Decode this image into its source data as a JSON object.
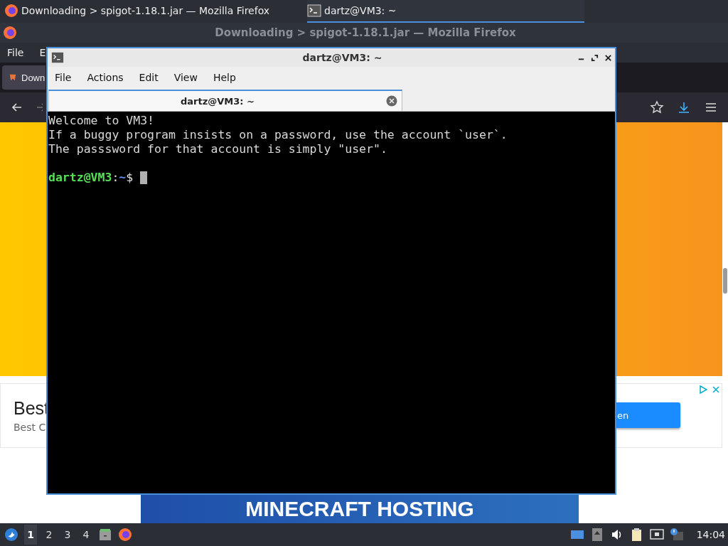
{
  "top_panel": {
    "tasks": [
      {
        "kind": "browser",
        "title": "Downloading > spigot-1.18.1.jar — Mozilla Firefox",
        "selected": false
      },
      {
        "kind": "terminal",
        "title": "dartz@VM3: ~",
        "selected": true
      }
    ]
  },
  "browser_window": {
    "title": "Downloading > spigot-1.18.1.jar — Mozilla Firefox",
    "menu": [
      "File",
      "E"
    ],
    "tab": "Down",
    "ad": {
      "title": "Best",
      "subtitle": "Best C",
      "button": "en"
    },
    "banner_text": "MINECRAFT HOSTING"
  },
  "terminal_window": {
    "title": "dartz@VM3: ~",
    "menu": [
      "File",
      "Actions",
      "Edit",
      "View",
      "Help"
    ],
    "tab": "dartz@VM3: ~",
    "lines": [
      "Welcome to VM3!",
      "If a buggy program insists on a password, use the account `user`.",
      "The passsword for that account is simply \"user\"."
    ],
    "prompt": {
      "user_host": "dartz@VM3",
      "separator": ":",
      "path": "~",
      "symbol": "$"
    }
  },
  "taskbar": {
    "workspaces": [
      {
        "label": "1",
        "selected": true
      },
      {
        "label": "2",
        "selected": false
      },
      {
        "label": "3",
        "selected": false
      },
      {
        "label": "4",
        "selected": false
      }
    ],
    "clock": "14:04"
  }
}
